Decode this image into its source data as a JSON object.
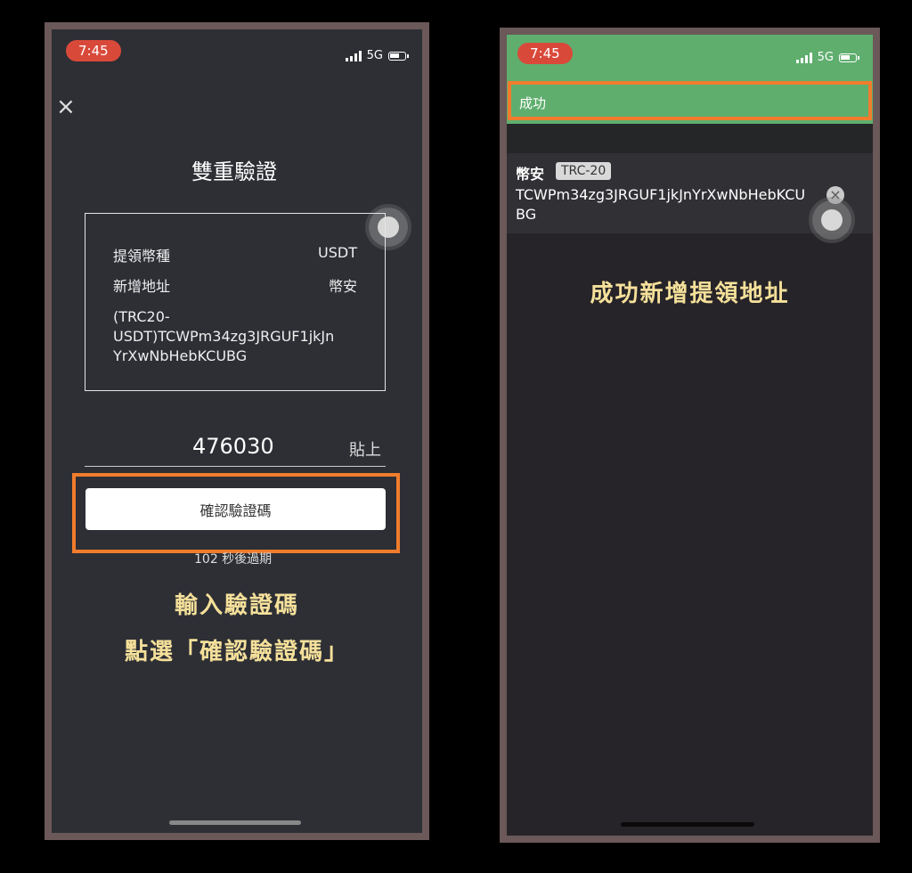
{
  "left_screen": {
    "status": {
      "time": "7:45",
      "network": "5G"
    },
    "title": "雙重驗證",
    "details": {
      "currency_label": "提領幣種",
      "currency_value": "USDT",
      "add_address_label": "新增地址",
      "add_address_value": "幣安",
      "address_line1": "(TRC20-",
      "address_line2": "USDT)TCWPm34zg3JRGUF1jkJn",
      "address_line3": "YrXwNbHebKCUBG"
    },
    "code_input": {
      "value": "476030",
      "paste_label": "貼上"
    },
    "confirm_button": "確認驗證碼",
    "countdown": "102 秒後過期",
    "caption_line1": "輸入驗證碼",
    "caption_line2": "點選「確認驗證碼」"
  },
  "right_screen": {
    "status": {
      "time": "7:45",
      "network": "5G"
    },
    "toast": "成功",
    "address_card": {
      "exchange": "幣安",
      "network": "TRC-20",
      "address": "TCWPm34zg3JRGUF1jkJnYrXwNbHebKCUBG"
    },
    "caption": "成功新增提領地址"
  },
  "colors": {
    "highlight": "#f07c2c",
    "success_green": "#5fae6e",
    "caption_yellow": "#f5e09a"
  }
}
